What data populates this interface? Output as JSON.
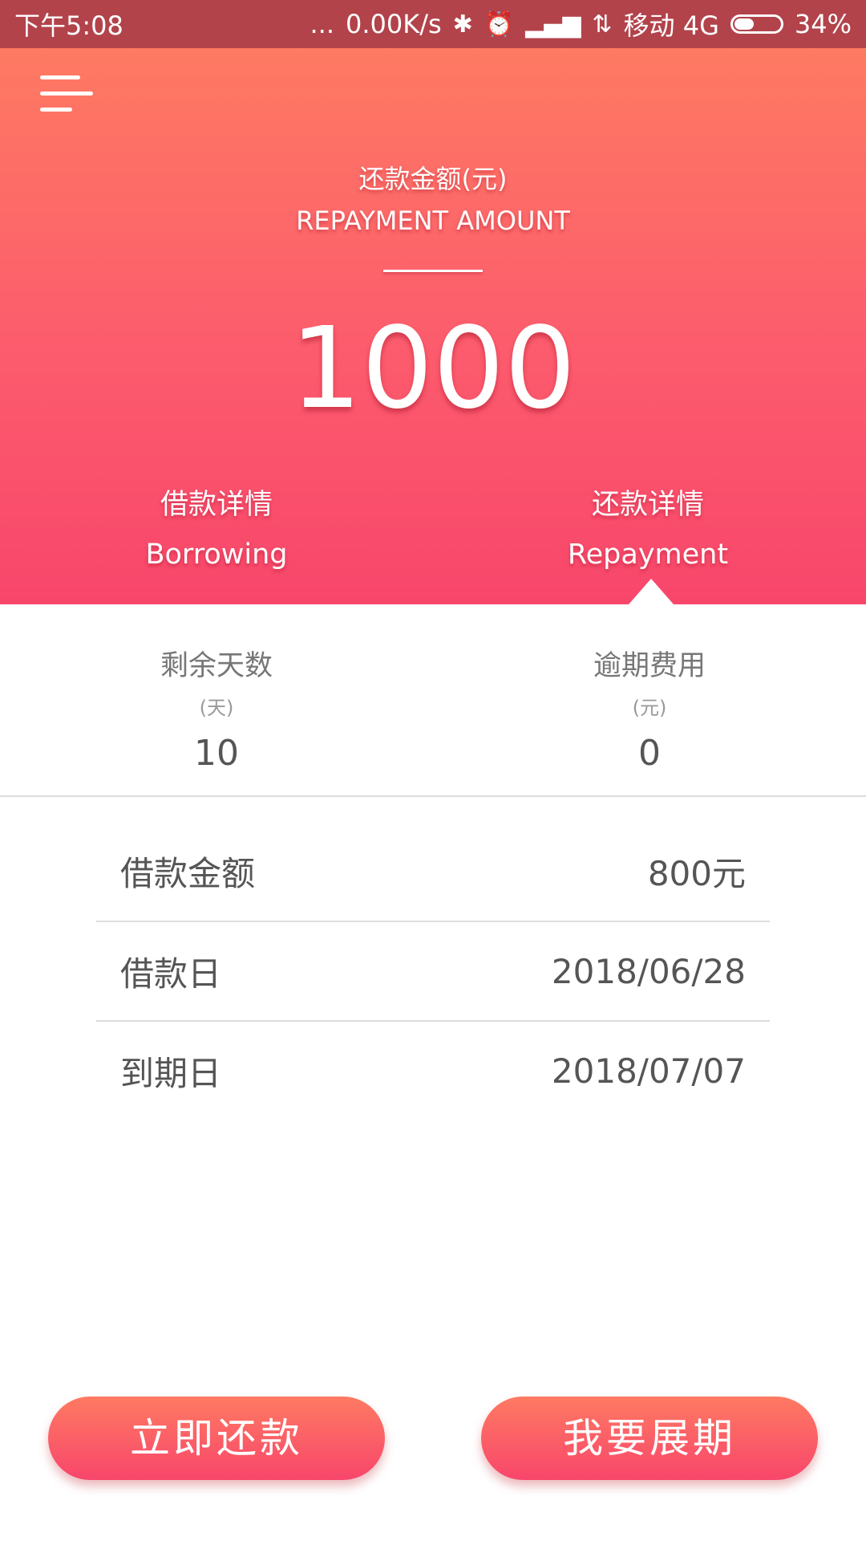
{
  "status_bar": {
    "time": "下午5:08",
    "dots": "...",
    "net_speed": "0.00K/s",
    "bluetooth": "bluetooth-icon",
    "alarm": "alarm-icon",
    "signal": "signal-icon",
    "carrier": "移动 4G",
    "battery": "34%"
  },
  "header": {
    "title_cn": "还款金额(元)",
    "title_en": "REPAYMENT AMOUNT",
    "amount": "1000"
  },
  "tabs": [
    {
      "cn": "借款详情",
      "en": "Borrowing"
    },
    {
      "cn": "还款详情",
      "en": "Repayment",
      "active": true
    }
  ],
  "stats": [
    {
      "label": "剩余天数",
      "unit": "(天)",
      "value": "10"
    },
    {
      "label": "逾期费用",
      "unit": "(元)",
      "value": "0"
    }
  ],
  "details": [
    {
      "label": "借款金额",
      "value": "800元"
    },
    {
      "label": "借款日",
      "value": "2018/06/28"
    },
    {
      "label": "到期日",
      "value": "2018/07/07"
    }
  ],
  "buttons": {
    "repay_now": "立即还款",
    "extend": "我要展期"
  },
  "colors": {
    "brand_top": "#fe7a62",
    "brand_bottom": "#f8466b",
    "status_bar": "#b2434b"
  }
}
